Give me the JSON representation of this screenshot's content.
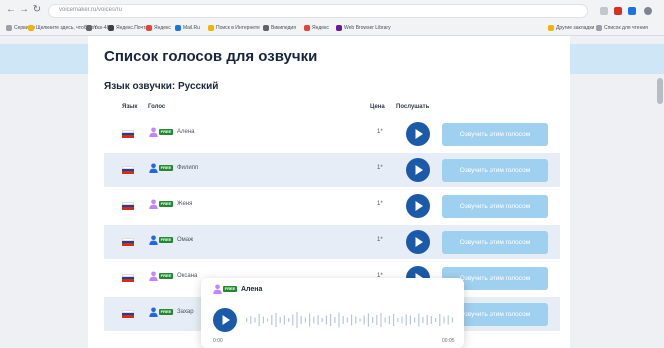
{
  "browser": {
    "url": "voicemaker.ru/voices/ru",
    "bookmarks": [
      {
        "label": "Сервисы"
      },
      {
        "label": "Щелкните здесь, чтобы от..."
      },
      {
        "label": "Yes-48"
      },
      {
        "label": "Яндекс.Почта"
      },
      {
        "label": "Яндекс"
      },
      {
        "label": "Mail.Ru"
      },
      {
        "label": "Поиск в Интернете"
      },
      {
        "label": "Википедия"
      },
      {
        "label": "Яндекс"
      },
      {
        "label": "Web Browser Library"
      },
      {
        "label": "Другие закладки"
      },
      {
        "label": "Список для чтения"
      }
    ]
  },
  "page": {
    "title": "Список голосов для озвучки",
    "language_line": "Язык озвучки: Русский",
    "columns": {
      "lang": "Язык",
      "voice": "Голос",
      "price": "Цена",
      "listen": "Послушать"
    },
    "voices": [
      {
        "name": "Алена",
        "price": "1*",
        "badge": "FREE",
        "avatar_color": "#c084fc",
        "cta": "Озвучить этим голосом"
      },
      {
        "name": "Филипп",
        "price": "1*",
        "badge": "FREE",
        "avatar_color": "#2563eb",
        "cta": "Озвучить этим голосом"
      },
      {
        "name": "Женя",
        "price": "1*",
        "badge": "FREE",
        "avatar_color": "#c084fc",
        "cta": "Озвучить этим голосом"
      },
      {
        "name": "Омаж",
        "price": "1*",
        "badge": "FREE",
        "avatar_color": "#2563eb",
        "cta": "Озвучить этим голосом"
      },
      {
        "name": "Оксана",
        "price": "1*",
        "badge": "FREE",
        "avatar_color": "#c084fc",
        "cta": "Озвучить этим голосом"
      },
      {
        "name": "Захар",
        "price": "1*",
        "badge": "FREE",
        "avatar_color": "#2563eb",
        "cta": "Озвучить этим голосом"
      }
    ]
  },
  "player": {
    "name": "Алена",
    "badge": "FREE",
    "time_current": "0:00",
    "time_total": "00:05",
    "progress": 0
  },
  "colors": {
    "accent": "#1b5aa8",
    "cta": "#9fd0ef",
    "row_alt": "#e6edf6",
    "badge": "#1f8b2e",
    "flag": [
      "#ffffff",
      "#1c3f94",
      "#d52b1e"
    ]
  },
  "icons": {
    "back": "arrow-left-icon",
    "forward": "arrow-right-icon",
    "reload": "reload-icon",
    "play": "play-icon",
    "avatar": "person-icon",
    "flag": "russia-flag-icon"
  }
}
